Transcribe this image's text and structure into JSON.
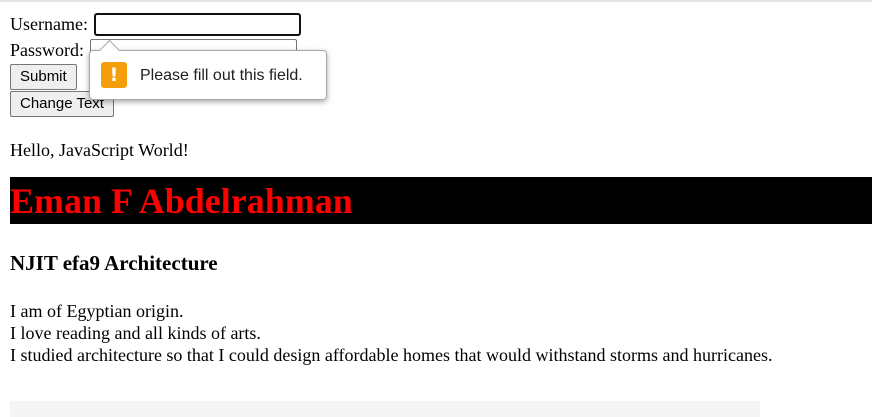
{
  "form": {
    "username_label": "Username:",
    "username_value": "",
    "password_label": "Password:",
    "password_value": "",
    "submit_label": "Submit",
    "change_text_label": "Change Text"
  },
  "validation_tooltip": {
    "icon": "warning-icon",
    "message": "Please fill out this field.",
    "icon_color": "#f59e0b"
  },
  "greeting": "Hello, JavaScript World!",
  "banner": {
    "text": "Eman F Abdelrahman",
    "background": "#000000",
    "color": "#ff0000"
  },
  "subheading": "NJIT efa9 Architecture",
  "bio": [
    "I am of Egyptian origin.",
    "I love reading and all kinds of arts.",
    "I studied architecture so that I could design affordable homes that would withstand storms and hurricanes."
  ]
}
